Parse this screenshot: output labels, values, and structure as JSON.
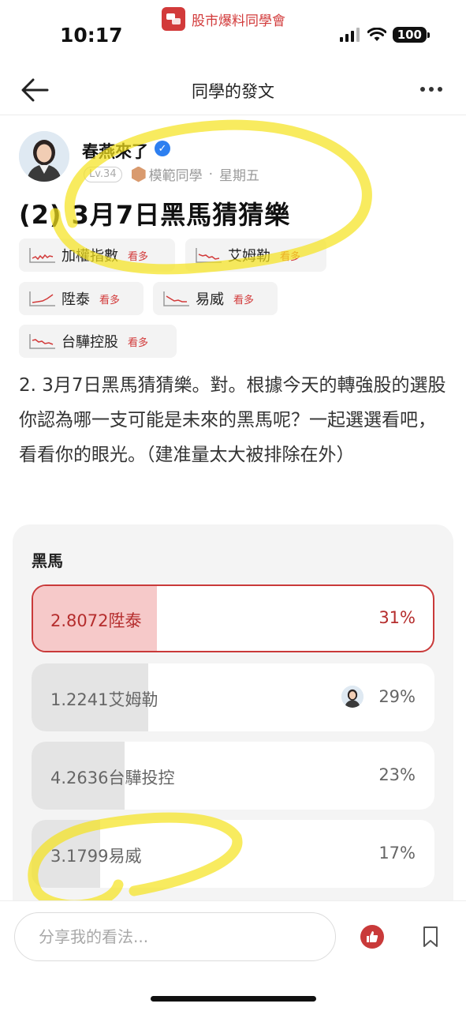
{
  "status_bar": {
    "time": "10:17",
    "app_name": "股市爆料同學會",
    "battery": "100"
  },
  "header": {
    "title": "同學的發文"
  },
  "author": {
    "name": "春燕來了",
    "level": "Lv.34",
    "role": "模範同學",
    "separator": "·",
    "posted": "星期五"
  },
  "post": {
    "title": "(2) 3月7日黑馬猜猜樂",
    "body": "2. 3月7日黑馬猜猜樂。對。根據今天的轉強股的選股你認為哪一支可能是未來的黑馬呢？一起選選看吧，看看你的眼光。（建准量太大被排除在外）"
  },
  "stock_chips": [
    {
      "name": "加權指數",
      "more": "看多"
    },
    {
      "name": "艾姆勒",
      "more": "看多"
    },
    {
      "name": "陞泰",
      "more": "看多"
    },
    {
      "name": "易威",
      "more": "看多"
    },
    {
      "name": "台驊控股",
      "more": "看多"
    }
  ],
  "poll": {
    "title": "黑馬",
    "options": [
      {
        "label": "2.8072陞泰",
        "percent": "31%",
        "share": 0.31,
        "selected": true
      },
      {
        "label": "1.2241艾姆勒",
        "percent": "29%",
        "share": 0.29,
        "selected": false
      },
      {
        "label": "4.2636台驊投控",
        "percent": "23%",
        "share": 0.23,
        "selected": false
      },
      {
        "label": "3.1799易威",
        "percent": "17%",
        "share": 0.17,
        "selected": false
      }
    ]
  },
  "bottom_bar": {
    "comment_placeholder": "分享我的看法..."
  },
  "colors": {
    "brand_red": "#c93a3a",
    "selected_fill": "#f6c9c9",
    "bar_fill": "#e4e4e4",
    "verified_blue": "#2d7ff0",
    "highlighter": "#f5e21b"
  },
  "icons": {
    "back": "arrow-left-icon",
    "more": "more-dots-icon",
    "verified": "verified-check-icon",
    "like": "thumbs-up-icon",
    "bookmark": "bookmark-icon"
  }
}
